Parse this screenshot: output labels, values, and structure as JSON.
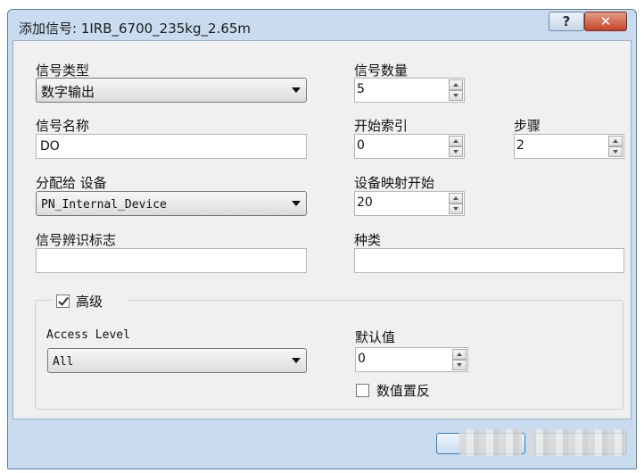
{
  "window": {
    "title": "添加信号: 1IRB_6700_235kg_2.65m",
    "help_label": "?",
    "close_label": "✕"
  },
  "fields": {
    "signal_type": {
      "label": "信号类型",
      "value": "数字输出"
    },
    "signal_count": {
      "label": "信号数量",
      "value": "5"
    },
    "signal_name": {
      "label": "信号名称",
      "value": "DO"
    },
    "start_index": {
      "label": "开始索引",
      "value": "0"
    },
    "step": {
      "label": "步骤",
      "value": "2"
    },
    "assign_device": {
      "label": "分配给 设备",
      "value": "PN_Internal_Device"
    },
    "device_mapping_start": {
      "label": "设备映射开始",
      "value": "20"
    },
    "signal_identification": {
      "label": "信号辨识标志",
      "value": ""
    },
    "category": {
      "label": "种类",
      "value": ""
    }
  },
  "advanced": {
    "label": "高级",
    "checked": true,
    "access_level": {
      "label": "Access Level",
      "value": "All"
    },
    "default_value": {
      "label": "默认值",
      "value": "0"
    },
    "invert_value": {
      "label": "数值置反",
      "checked": false
    }
  }
}
